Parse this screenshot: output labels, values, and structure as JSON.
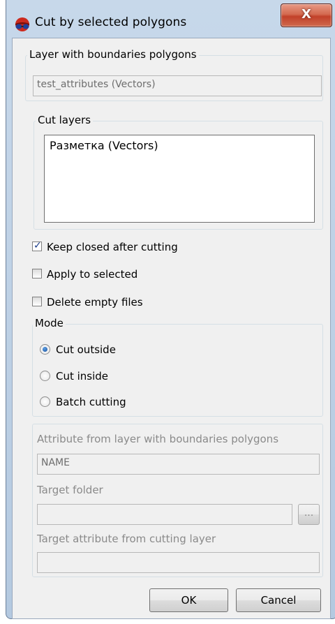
{
  "window": {
    "title": "Cut by selected polygons",
    "close_glyph": "X",
    "app_icon": "glasses-icon"
  },
  "boundaries_group": {
    "legend": "Layer with boundaries polygons",
    "value": "test_attributes (Vectors)"
  },
  "cut_layers": {
    "legend": "Cut layers",
    "items": [
      "Разметка (Vectors)"
    ]
  },
  "options": [
    {
      "label": "Keep closed after cutting",
      "checked": true
    },
    {
      "label": "Apply to selected",
      "checked": false
    },
    {
      "label": "Delete empty files",
      "checked": false
    }
  ],
  "mode": {
    "legend": "Mode",
    "options": [
      {
        "label": "Cut outside",
        "selected": true
      },
      {
        "label": "Cut inside",
        "selected": false
      },
      {
        "label": "Batch cutting",
        "selected": false
      }
    ]
  },
  "batch": {
    "attribute_label": "Attribute from layer with boundaries polygons",
    "attribute_value": "NAME",
    "target_folder_label": "Target folder",
    "target_folder_value": "",
    "browse_label": "...",
    "target_attribute_label": "Target attribute from cutting layer",
    "target_attribute_value": ""
  },
  "buttons": {
    "ok": "OK",
    "cancel": "Cancel"
  },
  "colors": {
    "frame": "#c7d8ea",
    "close_button": "#c2412a",
    "client_bg": "#f0f0f0"
  }
}
